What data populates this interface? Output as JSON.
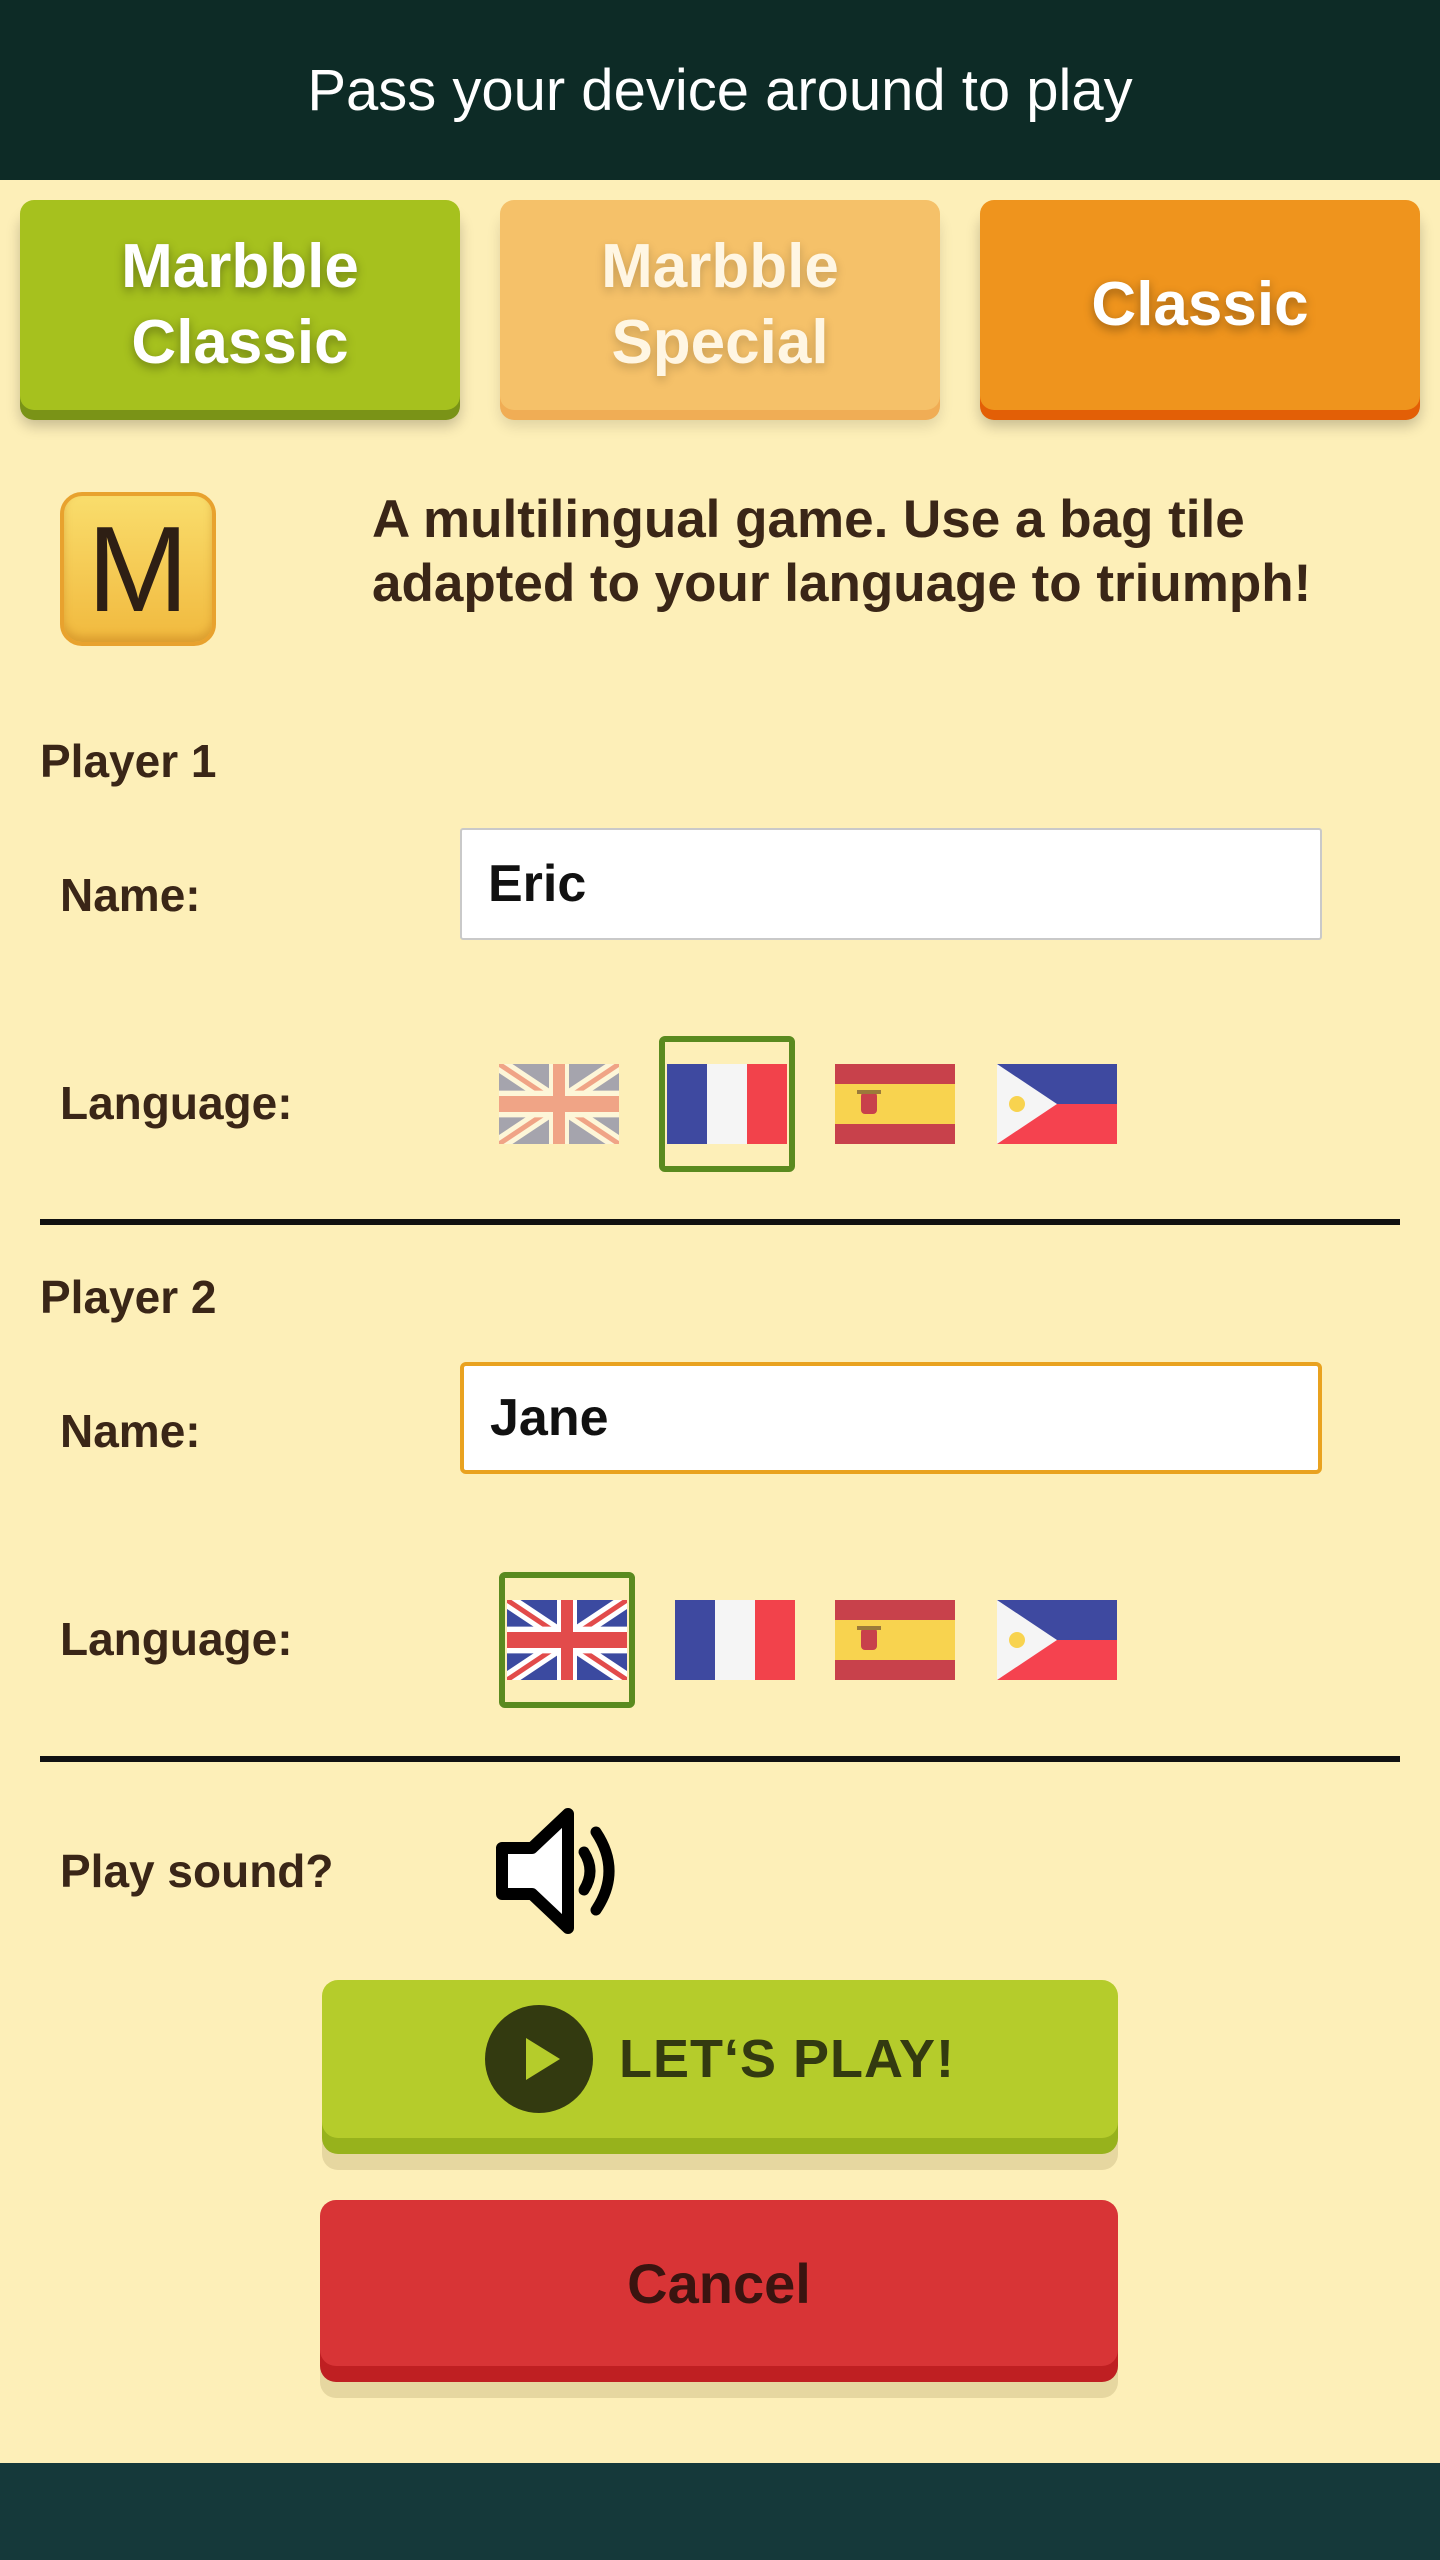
{
  "header": {
    "title": "Pass your device around to play"
  },
  "modes": [
    {
      "label_line1": "Marbble",
      "label_line2": "Classic",
      "color": "#a6c11e"
    },
    {
      "label_line1": "Marbble",
      "label_line2": "Special",
      "color": "#f5c169"
    },
    {
      "label_line1": "Classic",
      "color": "#ef941d"
    }
  ],
  "logo": {
    "letter": "M"
  },
  "intro": {
    "text": "A multilingual game. Use a bag tile adapted to your language to triumph!"
  },
  "players": [
    {
      "title": "Player 1",
      "name_label": "Name:",
      "name_value": "Eric",
      "language_label": "Language:",
      "languages": [
        "english-flag-icon",
        "french-flag-icon",
        "spanish-flag-icon",
        "philippine-flag-icon"
      ],
      "selected_language": "french-flag-icon"
    },
    {
      "title": "Player 2",
      "name_label": "Name:",
      "name_value": "Jane",
      "language_label": "Language:",
      "languages": [
        "english-flag-icon",
        "french-flag-icon",
        "spanish-flag-icon",
        "philippine-flag-icon"
      ],
      "selected_language": "english-flag-icon"
    }
  ],
  "sound": {
    "label": "Play sound?",
    "enabled": true,
    "icon": "speaker-icon"
  },
  "actions": {
    "play_label": "LET‘S PLAY!",
    "play_icon": "play-icon",
    "cancel_label": "Cancel"
  },
  "colors": {
    "background": "#fdefb8",
    "header": "#0d2b26",
    "selection": "#5a8a1f",
    "focus": "#e9a21f",
    "play": "#b5cc2b",
    "cancel": "#d83436"
  }
}
